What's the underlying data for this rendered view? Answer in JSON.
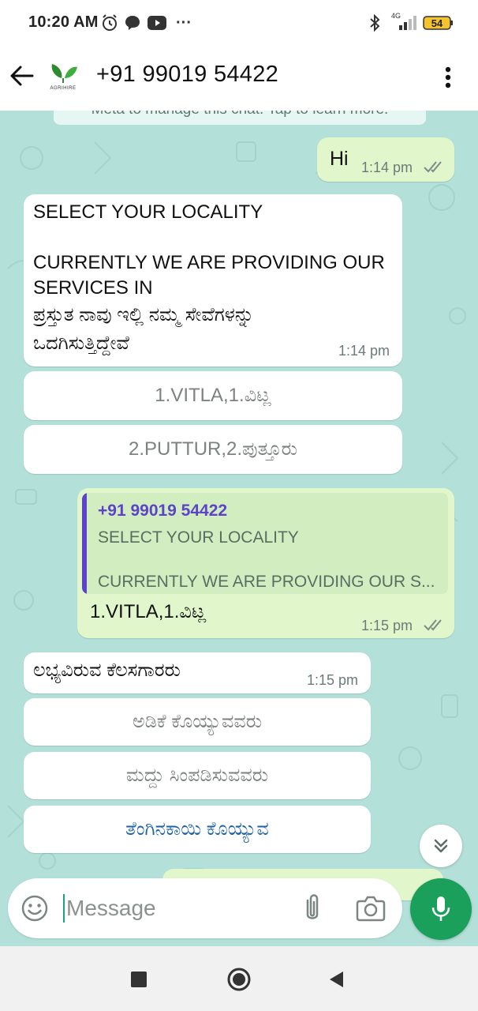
{
  "status_bar": {
    "time": "10:20 AM",
    "network": "4G",
    "battery": "54",
    "more": "···",
    "icons": [
      "alarm-icon",
      "messenger-icon",
      "youtube-icon",
      "bluetooth-icon",
      "signal-icon",
      "battery-icon"
    ]
  },
  "header": {
    "contact_name": "+91 99019 54422",
    "avatar_label": "AGRIHIRE",
    "icons": [
      "back-arrow-icon",
      "more-vert-icon"
    ]
  },
  "chat": {
    "system_notice": "Meta to manage this chat. Tap to learn more.",
    "messages": [
      {
        "direction": "out",
        "text": "Hi",
        "time": "1:14 pm",
        "status": "read"
      },
      {
        "direction": "in",
        "lines": [
          "SELECT YOUR LOCALITY",
          "CURRENTLY WE ARE PROVIDING OUR",
          "SERVICES IN",
          "ಪ್ರಸ್ತುತ ನಾವು ಇಲ್ಲಿ ನಮ್ಮ ಸೇವೆಗಳನ್ನು",
          "ಒದಗಿಸುತ್ತಿದ್ದೇವೆ"
        ],
        "time": "1:14 pm",
        "buttons": [
          "1.VITLA,1.ವಿಟ್ಲ",
          "2.PUTTUR,2.ಪುತ್ತೂರು"
        ]
      },
      {
        "direction": "out",
        "quote": {
          "author": "+91 99019 54422",
          "line1": "SELECT YOUR LOCALITY",
          "line2": "CURRENTLY WE ARE PROVIDING OUR S..."
        },
        "text": "1.VITLA,1.ವಿಟ್ಲ",
        "time": "1:15 pm",
        "status": "read"
      },
      {
        "direction": "in",
        "text": "ಲಭ್ಯವಿರುವ ಕೆಲಸಗಾರರು",
        "time": "1:15 pm",
        "buttons": [
          "ಅಡಿಕೆ ಕೊಯ್ಯುವವರು",
          "ಮದ್ದು ಸಿಂಪಡಿಸುವವರು",
          "ತೆಂಗಿನಕಾಯಿ  ಕೊಯ್ಯುವ"
        ]
      }
    ]
  },
  "composer": {
    "placeholder": "Message",
    "icons": [
      "emoji-icon",
      "attach-icon",
      "camera-icon",
      "mic-icon",
      "scroll-down-icon"
    ]
  },
  "nav": {
    "icons": [
      "recents-icon",
      "home-icon",
      "back-icon"
    ]
  },
  "colors": {
    "chat_background": "#b3e0d9",
    "outgoing_bubble": "#e1f7cb",
    "incoming_bubble": "#ffffff",
    "accent_green": "#1aa05b",
    "quote_bar": "#5b44c9",
    "link_blue": "#1e63a8"
  }
}
